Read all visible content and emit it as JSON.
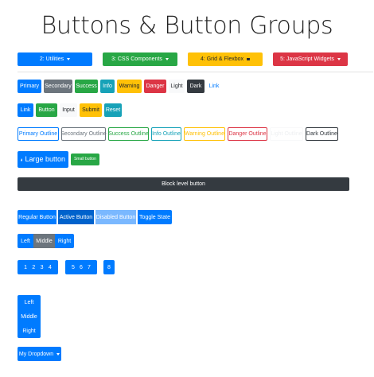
{
  "page": {
    "title": "Buttons & Button Groups"
  },
  "nav": [
    {
      "label": "2: Utilities",
      "color": "#007bff"
    },
    {
      "label": "3: CSS Components",
      "color": "#28a745"
    },
    {
      "label": "4: Grid & Flexbox",
      "color": "#ffc107"
    },
    {
      "label": "5: JavaScript Widgets",
      "color": "#dc3545"
    }
  ],
  "solid_buttons": [
    "Primary",
    "Secondary",
    "Success",
    "Info",
    "Warning",
    "Danger",
    "Light",
    "Dark",
    "Link"
  ],
  "element_buttons": [
    "Link",
    "Button",
    "Input",
    "Submit",
    "Reset"
  ],
  "outline_buttons": [
    "Primary Outline",
    "Secondary Outline",
    "Success Outline",
    "Info Outline",
    "Warning Outline",
    "Danger Outline",
    "Light Outline",
    "Dark Outline"
  ],
  "sizes": {
    "large": "Large button",
    "small": "Small button"
  },
  "block": "Block level button",
  "states": [
    "Regular Button",
    "Active Button",
    "Disabled Button",
    "Toggle State"
  ],
  "group": [
    "Left",
    "Middle",
    "Right"
  ],
  "pagination": {
    "group1": [
      "1",
      "2",
      "3",
      "4"
    ],
    "group2": [
      "5",
      "6",
      "7"
    ],
    "group3": [
      "8"
    ]
  },
  "vertical": [
    "Left",
    "Middle",
    "Right"
  ],
  "dropdown": "My Dropdown",
  "colors": {
    "primary": "#007bff",
    "secondary": "#6c757d",
    "success": "#28a745",
    "info": "#17a2b8",
    "warning": "#ffc107",
    "danger": "#dc3545",
    "light": "#f8f9fa",
    "dark": "#343a40"
  }
}
